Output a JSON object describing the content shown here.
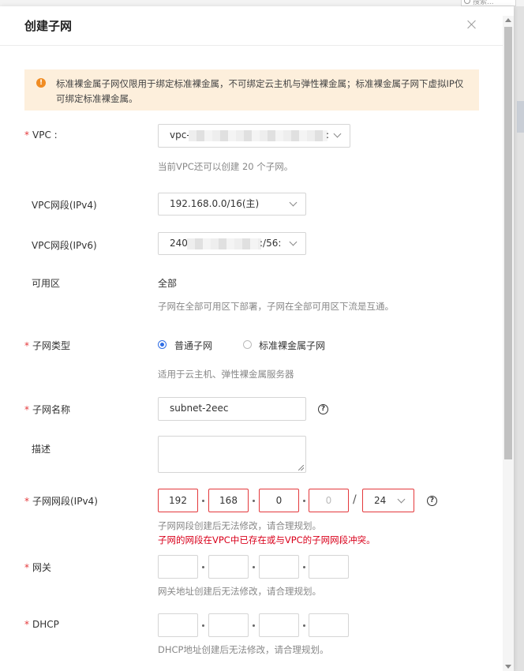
{
  "background": {
    "search_placeholder": "搜索..."
  },
  "modal": {
    "title": "创建子网"
  },
  "alert": {
    "text": "标准裸金属子网仅限用于绑定标准裸金属，不可绑定云主机与弹性裸金属；标准裸金属子网下虚拟IP仅可绑定标准裸金属。",
    "color": "#fdefdc",
    "icon_color": "#f08c23"
  },
  "form": {
    "required_mark": "*",
    "vpc": {
      "label": "VPC :",
      "value_prefix": "vpc-",
      "value_suffix": ":",
      "hint": "当前VPC还可以创建 20 个子网。"
    },
    "ipv4_range": {
      "label": "VPC网段(IPv4)",
      "value": "192.168.0.0/16(主)"
    },
    "ipv6_range": {
      "label": "VPC网段(IPv6)",
      "value_prefix": "240",
      "value_suffix": ":/56:"
    },
    "az": {
      "label": "可用区",
      "value": "全部",
      "hint": "子网在全部可用区下部署，子网在全部可用区下流是互通。"
    },
    "subnet_type": {
      "label": "子网类型",
      "options": [
        "普通子网",
        "标准裸金属子网"
      ],
      "selected": "普通子网",
      "hint": "适用于云主机、弹性裸金属服务器"
    },
    "subnet_name": {
      "label": "子网名称",
      "value": "subnet-2eec"
    },
    "description": {
      "label": "描述",
      "value": ""
    },
    "subnet_cidr": {
      "label": "子网网段(IPv4)",
      "octets": [
        "192",
        "168",
        "0",
        "0"
      ],
      "mask": "24",
      "separator": "/",
      "hint": "子网网段创建后无法修改，请合理规划。",
      "error": "子网的网段在VPC中已存在或与VPC的子网网段冲突。",
      "error_color": "#d9001b"
    },
    "gateway": {
      "label": "网关",
      "octets": [
        "",
        "",
        "",
        ""
      ],
      "hint": "网关地址创建后无法修改，请合理规划。"
    },
    "dhcp": {
      "label": "DHCP",
      "octets": [
        "",
        "",
        "",
        ""
      ],
      "hint": "DHCP地址创建后无法修改，请合理规划。"
    }
  },
  "icons": {
    "close": "close-icon",
    "warning": "warning-icon",
    "help": "help-icon",
    "chevron": "chevron-down-icon"
  },
  "accent_color": "#2f6ee6"
}
